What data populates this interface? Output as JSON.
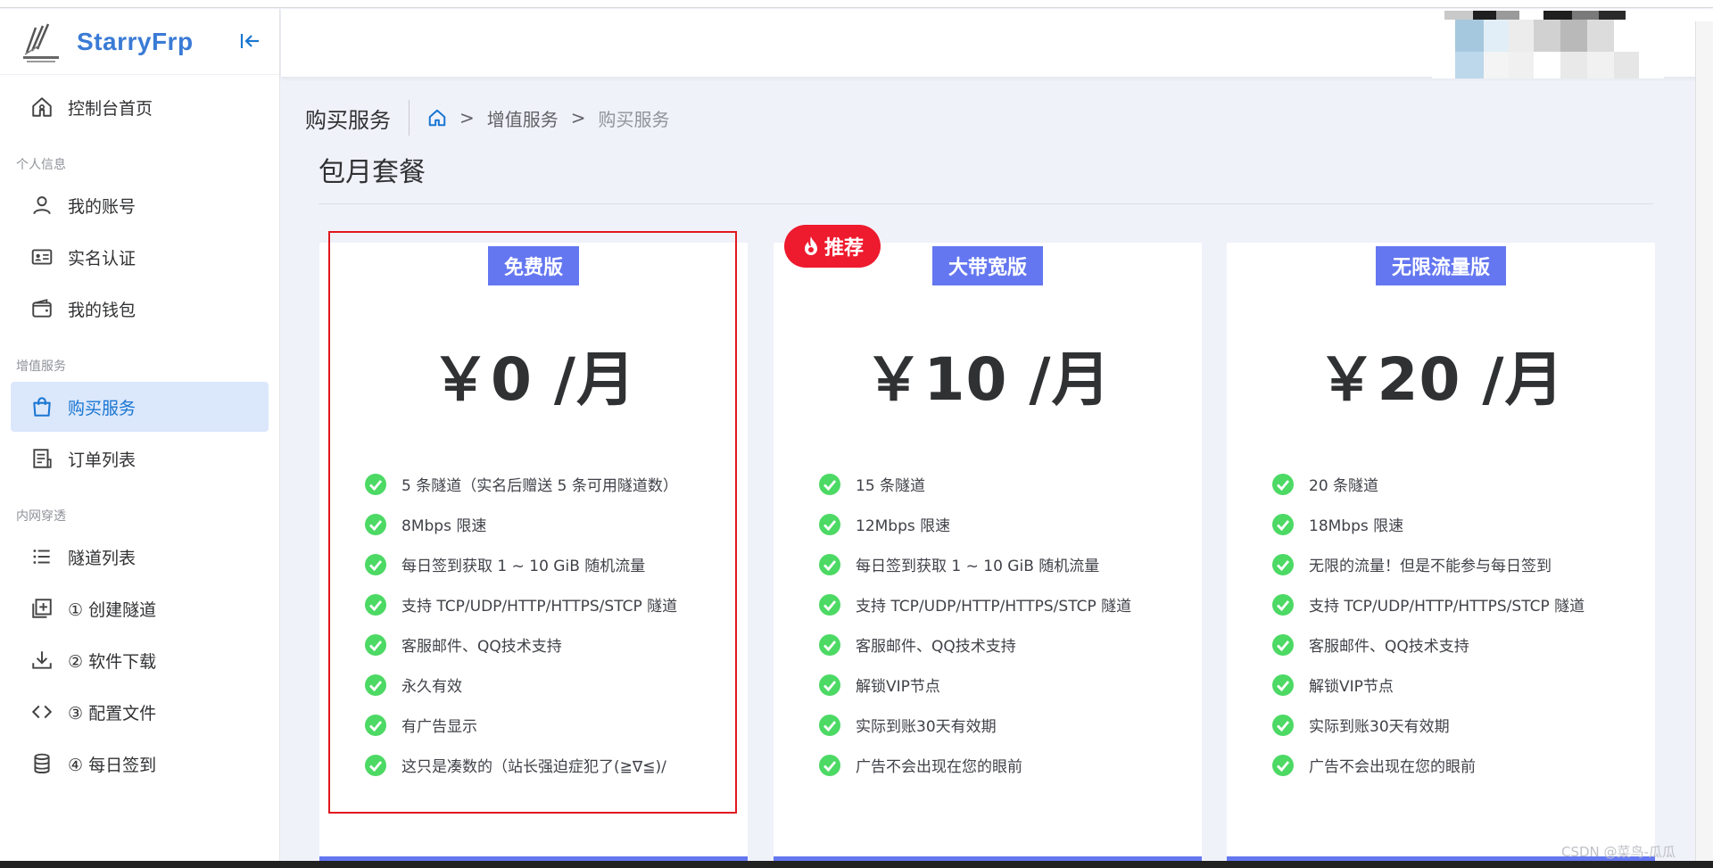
{
  "brand": {
    "name": "StarryFrp"
  },
  "sidebar": {
    "items": [
      {
        "label": "控制台首页",
        "icon": "home-icon",
        "group": null
      },
      {
        "group_label": "个人信息"
      },
      {
        "label": "我的账号",
        "icon": "user-icon"
      },
      {
        "label": "实名认证",
        "icon": "id-card-icon"
      },
      {
        "label": "我的钱包",
        "icon": "wallet-icon"
      },
      {
        "group_label": "增值服务"
      },
      {
        "label": "购买服务",
        "icon": "shopping-bag-icon",
        "active": true
      },
      {
        "label": "订单列表",
        "icon": "receipt-icon"
      },
      {
        "group_label": "内网穿透"
      },
      {
        "label": "隧道列表",
        "icon": "list-icon"
      },
      {
        "label": "① 创建隧道",
        "icon": "add-box-icon"
      },
      {
        "label": "② 软件下载",
        "icon": "download-icon"
      },
      {
        "label": "③ 配置文件",
        "icon": "code-icon"
      },
      {
        "label": "④ 每日签到",
        "icon": "database-icon"
      }
    ]
  },
  "breadcrumb": {
    "title": "购买服务",
    "path": [
      "增值服务",
      "购买服务"
    ]
  },
  "section": {
    "title": "包月套餐"
  },
  "plans": [
    {
      "tag": "免费版",
      "price": "￥0 /月",
      "features": [
        "5 条隧道（实名后赠送 5 条可用隧道数）",
        "8Mbps 限速",
        "每日签到获取 1 ~ 10 GiB 随机流量",
        "支持 TCP/UDP/HTTP/HTTPS/STCP 隧道",
        "客服邮件、QQ技术支持",
        "永久有效",
        "有广告显示",
        "这只是凑数的（站长强迫症犯了(≧∇≦)/"
      ]
    },
    {
      "tag": "大带宽版",
      "badge": "推荐",
      "price": "￥10 /月",
      "features": [
        "15 条隧道",
        "12Mbps 限速",
        "每日签到获取 1 ~ 10 GiB 随机流量",
        "支持 TCP/UDP/HTTP/HTTPS/STCP 隧道",
        "客服邮件、QQ技术支持",
        "解锁VIP节点",
        "实际到账30天有效期",
        "广告不会出现在您的眼前"
      ]
    },
    {
      "tag": "无限流量版",
      "price": "￥20 /月",
      "features": [
        "20 条隧道",
        "18Mbps 限速",
        "无限的流量！但是不能参与每日签到",
        "支持 TCP/UDP/HTTP/HTTPS/STCP 隧道",
        "客服邮件、QQ技术支持",
        "解锁VIP节点",
        "实际到账30天有效期",
        "广告不会出现在您的眼前"
      ]
    }
  ],
  "watermark": "CSDN @菜鸟-瓜瓜",
  "colors": {
    "accent": "#6477f0",
    "brand": "#3a7bd5",
    "check": "#4cd964",
    "hot": "#ee1a2e",
    "highlight": "#e0191f",
    "active_bg": "#dbe7fb"
  }
}
